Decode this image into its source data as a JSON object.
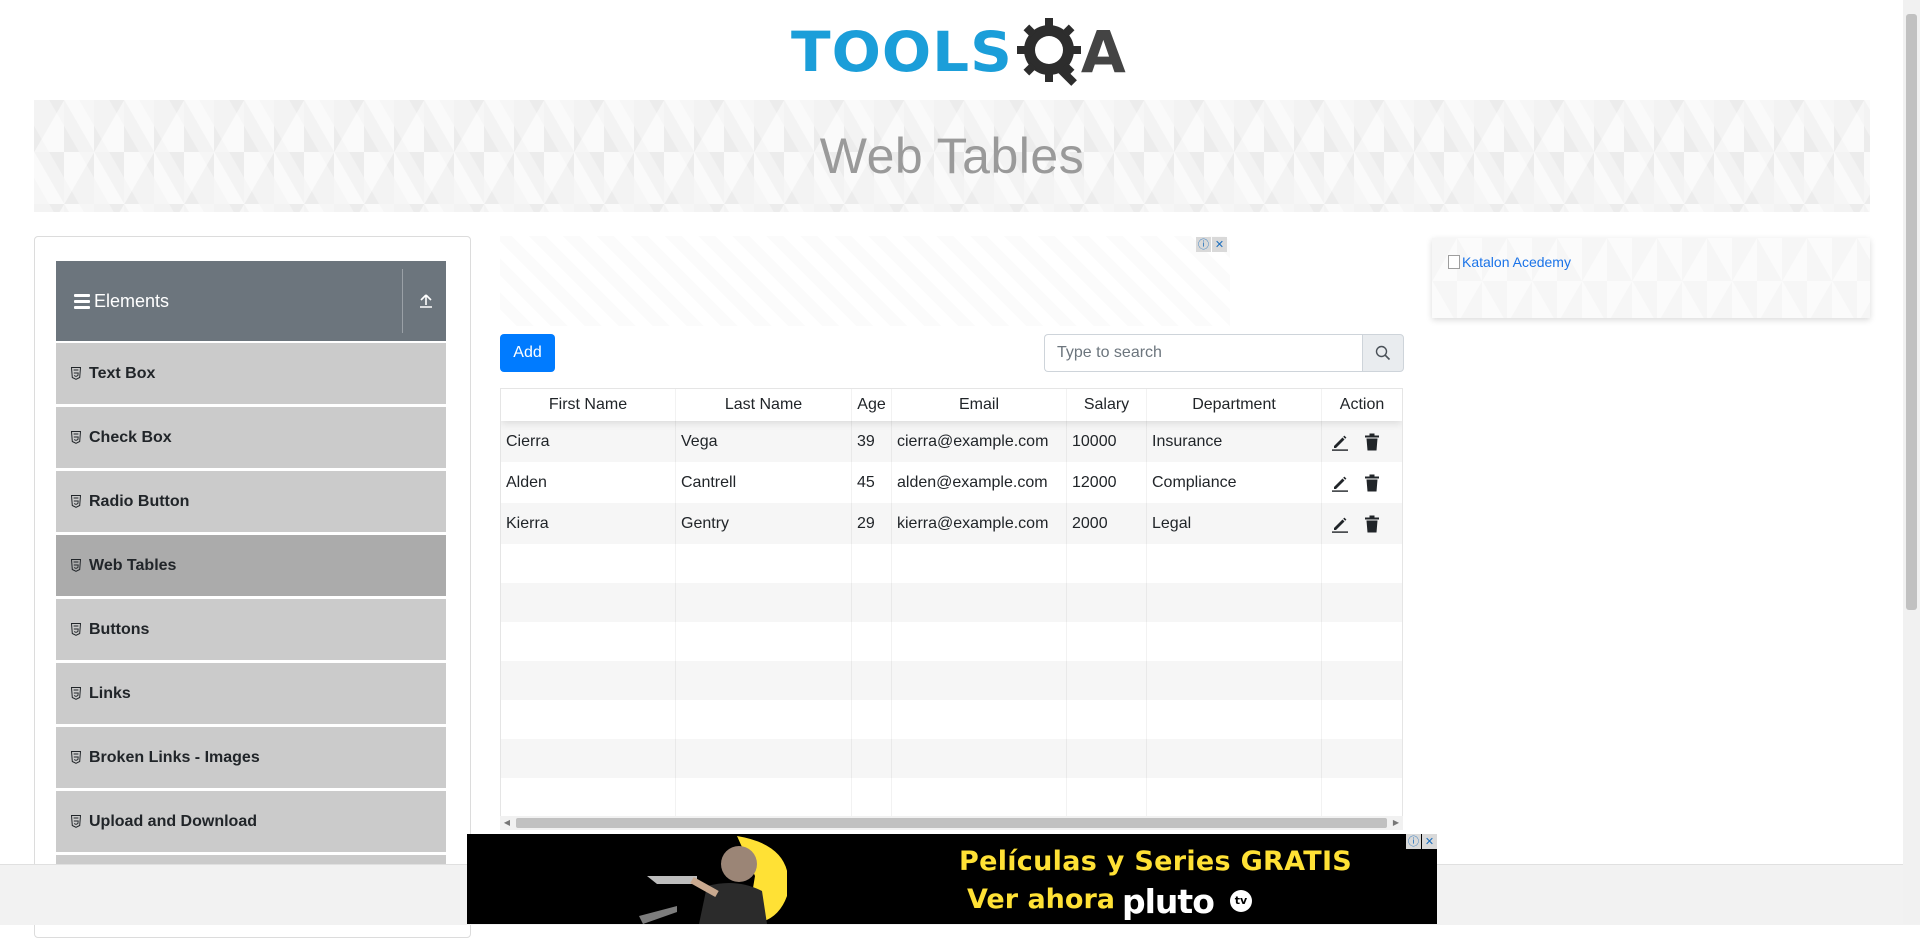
{
  "logo": {
    "text_left": "TOOLS",
    "text_right": "A"
  },
  "banner": {
    "title": "Web Tables"
  },
  "sidebar": {
    "group_title": "Elements",
    "items": [
      {
        "label": "Text Box",
        "active": false
      },
      {
        "label": "Check Box",
        "active": false
      },
      {
        "label": "Radio Button",
        "active": false
      },
      {
        "label": "Web Tables",
        "active": true
      },
      {
        "label": "Buttons",
        "active": false
      },
      {
        "label": "Links",
        "active": false
      },
      {
        "label": "Broken Links - Images",
        "active": false
      },
      {
        "label": "Upload and Download",
        "active": false
      }
    ]
  },
  "toolbar": {
    "add_label": "Add"
  },
  "search": {
    "placeholder": "Type to search",
    "value": ""
  },
  "table": {
    "columns": [
      "First Name",
      "Last Name",
      "Age",
      "Email",
      "Salary",
      "Department",
      "Action"
    ],
    "rows": [
      {
        "first": "Cierra",
        "last": "Vega",
        "age": "39",
        "email": "cierra@example.com",
        "salary": "10000",
        "department": "Insurance"
      },
      {
        "first": "Alden",
        "last": "Cantrell",
        "age": "45",
        "email": "alden@example.com",
        "salary": "12000",
        "department": "Compliance"
      },
      {
        "first": "Kierra",
        "last": "Gentry",
        "age": "29",
        "email": "kierra@example.com",
        "salary": "2000",
        "department": "Legal"
      }
    ]
  },
  "side_ad": {
    "alt_text": "Katalon Acedemy"
  },
  "bottom_ad": {
    "line1": "Películas y Series GRATIS",
    "line2": "Ver ahora",
    "brand": "pluto",
    "brand_suffix": "tv"
  },
  "colors": {
    "accent": "#007bff",
    "logo_blue": "#1b9ed9",
    "sidebar_header": "#6c757d",
    "menu_item": "#cbcbcb",
    "menu_active": "#ababab"
  },
  "icons": {
    "search": "search-icon",
    "edit": "pencil-icon",
    "delete": "trash-icon",
    "menu": "hamburger-icon",
    "collapse": "upload-icon"
  }
}
